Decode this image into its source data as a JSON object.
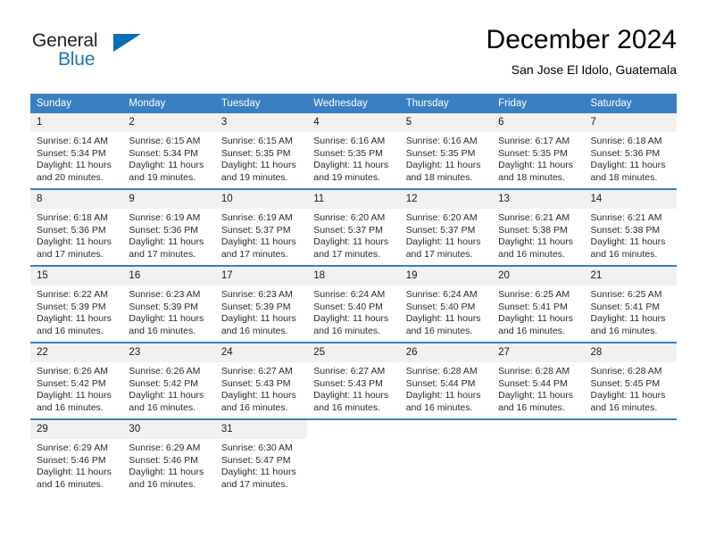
{
  "brand": {
    "name_part1": "General",
    "name_part2": "Blue",
    "triangle_color": "#0b6cb7",
    "blue_color": "#1b75bb"
  },
  "header": {
    "title": "December 2024",
    "subtitle": "San Jose El Idolo, Guatemala"
  },
  "theme": {
    "header_row_bg": "#3a7fc1",
    "daynum_bg": "#f1f1f1",
    "row_divider": "#3a7fc1"
  },
  "weekdays": [
    "Sunday",
    "Monday",
    "Tuesday",
    "Wednesday",
    "Thursday",
    "Friday",
    "Saturday"
  ],
  "weeks": [
    [
      {
        "day": "1",
        "sunrise": "Sunrise: 6:14 AM",
        "sunset": "Sunset: 5:34 PM",
        "daylight": "Daylight: 11 hours and 20 minutes."
      },
      {
        "day": "2",
        "sunrise": "Sunrise: 6:15 AM",
        "sunset": "Sunset: 5:34 PM",
        "daylight": "Daylight: 11 hours and 19 minutes."
      },
      {
        "day": "3",
        "sunrise": "Sunrise: 6:15 AM",
        "sunset": "Sunset: 5:35 PM",
        "daylight": "Daylight: 11 hours and 19 minutes."
      },
      {
        "day": "4",
        "sunrise": "Sunrise: 6:16 AM",
        "sunset": "Sunset: 5:35 PM",
        "daylight": "Daylight: 11 hours and 19 minutes."
      },
      {
        "day": "5",
        "sunrise": "Sunrise: 6:16 AM",
        "sunset": "Sunset: 5:35 PM",
        "daylight": "Daylight: 11 hours and 18 minutes."
      },
      {
        "day": "6",
        "sunrise": "Sunrise: 6:17 AM",
        "sunset": "Sunset: 5:35 PM",
        "daylight": "Daylight: 11 hours and 18 minutes."
      },
      {
        "day": "7",
        "sunrise": "Sunrise: 6:18 AM",
        "sunset": "Sunset: 5:36 PM",
        "daylight": "Daylight: 11 hours and 18 minutes."
      }
    ],
    [
      {
        "day": "8",
        "sunrise": "Sunrise: 6:18 AM",
        "sunset": "Sunset: 5:36 PM",
        "daylight": "Daylight: 11 hours and 17 minutes."
      },
      {
        "day": "9",
        "sunrise": "Sunrise: 6:19 AM",
        "sunset": "Sunset: 5:36 PM",
        "daylight": "Daylight: 11 hours and 17 minutes."
      },
      {
        "day": "10",
        "sunrise": "Sunrise: 6:19 AM",
        "sunset": "Sunset: 5:37 PM",
        "daylight": "Daylight: 11 hours and 17 minutes."
      },
      {
        "day": "11",
        "sunrise": "Sunrise: 6:20 AM",
        "sunset": "Sunset: 5:37 PM",
        "daylight": "Daylight: 11 hours and 17 minutes."
      },
      {
        "day": "12",
        "sunrise": "Sunrise: 6:20 AM",
        "sunset": "Sunset: 5:37 PM",
        "daylight": "Daylight: 11 hours and 17 minutes."
      },
      {
        "day": "13",
        "sunrise": "Sunrise: 6:21 AM",
        "sunset": "Sunset: 5:38 PM",
        "daylight": "Daylight: 11 hours and 16 minutes."
      },
      {
        "day": "14",
        "sunrise": "Sunrise: 6:21 AM",
        "sunset": "Sunset: 5:38 PM",
        "daylight": "Daylight: 11 hours and 16 minutes."
      }
    ],
    [
      {
        "day": "15",
        "sunrise": "Sunrise: 6:22 AM",
        "sunset": "Sunset: 5:39 PM",
        "daylight": "Daylight: 11 hours and 16 minutes."
      },
      {
        "day": "16",
        "sunrise": "Sunrise: 6:23 AM",
        "sunset": "Sunset: 5:39 PM",
        "daylight": "Daylight: 11 hours and 16 minutes."
      },
      {
        "day": "17",
        "sunrise": "Sunrise: 6:23 AM",
        "sunset": "Sunset: 5:39 PM",
        "daylight": "Daylight: 11 hours and 16 minutes."
      },
      {
        "day": "18",
        "sunrise": "Sunrise: 6:24 AM",
        "sunset": "Sunset: 5:40 PM",
        "daylight": "Daylight: 11 hours and 16 minutes."
      },
      {
        "day": "19",
        "sunrise": "Sunrise: 6:24 AM",
        "sunset": "Sunset: 5:40 PM",
        "daylight": "Daylight: 11 hours and 16 minutes."
      },
      {
        "day": "20",
        "sunrise": "Sunrise: 6:25 AM",
        "sunset": "Sunset: 5:41 PM",
        "daylight": "Daylight: 11 hours and 16 minutes."
      },
      {
        "day": "21",
        "sunrise": "Sunrise: 6:25 AM",
        "sunset": "Sunset: 5:41 PM",
        "daylight": "Daylight: 11 hours and 16 minutes."
      }
    ],
    [
      {
        "day": "22",
        "sunrise": "Sunrise: 6:26 AM",
        "sunset": "Sunset: 5:42 PM",
        "daylight": "Daylight: 11 hours and 16 minutes."
      },
      {
        "day": "23",
        "sunrise": "Sunrise: 6:26 AM",
        "sunset": "Sunset: 5:42 PM",
        "daylight": "Daylight: 11 hours and 16 minutes."
      },
      {
        "day": "24",
        "sunrise": "Sunrise: 6:27 AM",
        "sunset": "Sunset: 5:43 PM",
        "daylight": "Daylight: 11 hours and 16 minutes."
      },
      {
        "day": "25",
        "sunrise": "Sunrise: 6:27 AM",
        "sunset": "Sunset: 5:43 PM",
        "daylight": "Daylight: 11 hours and 16 minutes."
      },
      {
        "day": "26",
        "sunrise": "Sunrise: 6:28 AM",
        "sunset": "Sunset: 5:44 PM",
        "daylight": "Daylight: 11 hours and 16 minutes."
      },
      {
        "day": "27",
        "sunrise": "Sunrise: 6:28 AM",
        "sunset": "Sunset: 5:44 PM",
        "daylight": "Daylight: 11 hours and 16 minutes."
      },
      {
        "day": "28",
        "sunrise": "Sunrise: 6:28 AM",
        "sunset": "Sunset: 5:45 PM",
        "daylight": "Daylight: 11 hours and 16 minutes."
      }
    ],
    [
      {
        "day": "29",
        "sunrise": "Sunrise: 6:29 AM",
        "sunset": "Sunset: 5:46 PM",
        "daylight": "Daylight: 11 hours and 16 minutes."
      },
      {
        "day": "30",
        "sunrise": "Sunrise: 6:29 AM",
        "sunset": "Sunset: 5:46 PM",
        "daylight": "Daylight: 11 hours and 16 minutes."
      },
      {
        "day": "31",
        "sunrise": "Sunrise: 6:30 AM",
        "sunset": "Sunset: 5:47 PM",
        "daylight": "Daylight: 11 hours and 17 minutes."
      },
      {
        "day": "",
        "sunrise": "",
        "sunset": "",
        "daylight": ""
      },
      {
        "day": "",
        "sunrise": "",
        "sunset": "",
        "daylight": ""
      },
      {
        "day": "",
        "sunrise": "",
        "sunset": "",
        "daylight": ""
      },
      {
        "day": "",
        "sunrise": "",
        "sunset": "",
        "daylight": ""
      }
    ]
  ]
}
